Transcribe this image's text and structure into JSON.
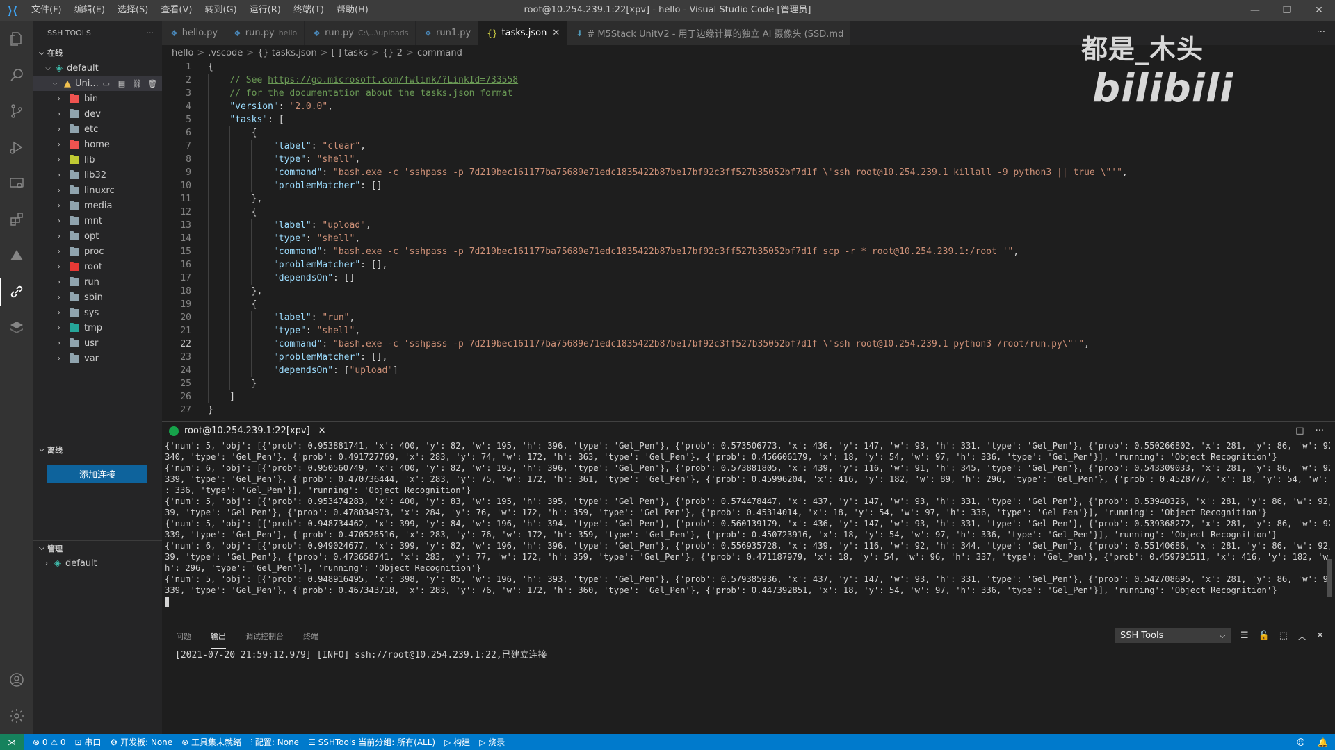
{
  "window": {
    "title": "root@10.254.239.1:22[xpv] - hello - Visual Studio Code [管理员]",
    "menu": [
      "文件(F)",
      "编辑(E)",
      "选择(S)",
      "查看(V)",
      "转到(G)",
      "运行(R)",
      "终端(T)",
      "帮助(H)"
    ],
    "controls": {
      "minimize": "—",
      "restore": "❐",
      "close": "✕"
    }
  },
  "sidebar": {
    "title": "SSH TOOLS",
    "more": "···",
    "online_section": "在线",
    "group": "default",
    "host": "Uni...",
    "folders": [
      {
        "name": "bin",
        "color": "#ef5350"
      },
      {
        "name": "dev",
        "color": "#90a4ae"
      },
      {
        "name": "etc",
        "color": "#90a4ae"
      },
      {
        "name": "home",
        "color": "#ef5350"
      },
      {
        "name": "lib",
        "color": "#c0ca33"
      },
      {
        "name": "lib32",
        "color": "#90a4ae"
      },
      {
        "name": "linuxrc",
        "color": "#90a4ae"
      },
      {
        "name": "media",
        "color": "#90a4ae"
      },
      {
        "name": "mnt",
        "color": "#90a4ae"
      },
      {
        "name": "opt",
        "color": "#90a4ae"
      },
      {
        "name": "proc",
        "color": "#90a4ae"
      },
      {
        "name": "root",
        "color": "#e53935"
      },
      {
        "name": "run",
        "color": "#90a4ae"
      },
      {
        "name": "sbin",
        "color": "#90a4ae"
      },
      {
        "name": "sys",
        "color": "#90a4ae"
      },
      {
        "name": "tmp",
        "color": "#26a69a"
      },
      {
        "name": "usr",
        "color": "#90a4ae"
      },
      {
        "name": "var",
        "color": "#90a4ae"
      }
    ],
    "offline_section": "离线",
    "add_button": "添加连接",
    "manage_section": "管理",
    "manage_group": "default"
  },
  "tabs": [
    {
      "label": "hello.py",
      "desc": "",
      "icon": "python-icon",
      "active": false
    },
    {
      "label": "run.py",
      "desc": "hello",
      "icon": "python-icon",
      "active": false
    },
    {
      "label": "run.py",
      "desc": "C:\\...\\uploads",
      "icon": "python-icon",
      "active": false
    },
    {
      "label": "run1.py",
      "desc": "",
      "icon": "python-icon",
      "active": false
    },
    {
      "label": "tasks.json",
      "desc": "",
      "icon": "json-icon",
      "active": true
    },
    {
      "label": "# M5Stack UnitV2 - 用于边缘计算的独立 AI 摄像头 (SSD.md",
      "desc": "",
      "icon": "markdown-icon",
      "active": false
    }
  ],
  "breadcrumb": [
    "hello",
    ".vscode",
    "{} tasks.json",
    "[ ] tasks",
    "{} 2",
    "command"
  ],
  "editor": {
    "current_line": 22,
    "lines": [
      "{",
      "    // See https://go.microsoft.com/fwlink/?LinkId=733558",
      "    // for the documentation about the tasks.json format",
      "    \"version\": \"2.0.0\",",
      "    \"tasks\": [",
      "        {",
      "            \"label\": \"clear\",",
      "            \"type\": \"shell\",",
      "            \"command\": \"bash.exe -c 'sshpass -p 7d219bec161177ba75689e71edc1835422b87be17bf92c3ff527b35052bf7d1f \\\"ssh root@10.254.239.1 killall -9 python3 || true \\\"'\",",
      "            \"problemMatcher\": []",
      "        },",
      "        {",
      "            \"label\": \"upload\",",
      "            \"type\": \"shell\",",
      "            \"command\": \"bash.exe -c 'sshpass -p 7d219bec161177ba75689e71edc1835422b87be17bf92c3ff527b35052bf7d1f scp -r * root@10.254.239.1:/root '\",",
      "            \"problemMatcher\": [],",
      "            \"dependsOn\": []",
      "        },",
      "        {",
      "            \"label\": \"run\",",
      "            \"type\": \"shell\",",
      "            \"command\": \"bash.exe -c 'sshpass -p 7d219bec161177ba75689e71edc1835422b87be17bf92c3ff527b35052bf7d1f \\\"ssh root@10.254.239.1 python3 /root/run.py\\\"'\",",
      "            \"problemMatcher\": [],",
      "            \"dependsOn\": [\"upload\"]",
      "        }",
      "    ]",
      "}"
    ]
  },
  "watermark": {
    "text": "都是_木头",
    "brand": "bilibili"
  },
  "terminal": {
    "tab_label": "root@10.254.239.1:22[xpv]",
    "lines": [
      "{'num': 5, 'obj': [{'prob': 0.953881741, 'x': 400, 'y': 82, 'w': 195, 'h': 396, 'type': 'Gel_Pen'}, {'prob': 0.573506773, 'x': 436, 'y': 147, 'w': 93, 'h': 331, 'type': 'Gel_Pen'}, {'prob': 0.550266802, 'x': 281, 'y': 86, 'w': 92, 'h':",
      "340, 'type': 'Gel_Pen'}, {'prob': 0.491727769, 'x': 283, 'y': 74, 'w': 172, 'h': 363, 'type': 'Gel_Pen'}, {'prob': 0.456606179, 'x': 18, 'y': 54, 'w': 97, 'h': 336, 'type': 'Gel_Pen'}], 'running': 'Object Recognition'}",
      "{'num': 6, 'obj': [{'prob': 0.950560749, 'x': 400, 'y': 82, 'w': 195, 'h': 396, 'type': 'Gel_Pen'}, {'prob': 0.573881805, 'x': 439, 'y': 116, 'w': 91, 'h': 345, 'type': 'Gel_Pen'}, {'prob': 0.543309033, 'x': 281, 'y': 86, 'w': 92, 'h':",
      "339, 'type': 'Gel_Pen'}, {'prob': 0.470736444, 'x': 283, 'y': 75, 'w': 172, 'h': 361, 'type': 'Gel_Pen'}, {'prob': 0.45996204, 'x': 416, 'y': 182, 'w': 89, 'h': 296, 'type': 'Gel_Pen'}, {'prob': 0.4528777, 'x': 18, 'y': 54, 'w': 97, 'h'",
      ": 336, 'type': 'Gel_Pen'}], 'running': 'Object Recognition'}",
      "{'num': 5, 'obj': [{'prob': 0.953474283, 'x': 400, 'y': 83, 'w': 195, 'h': 395, 'type': 'Gel_Pen'}, {'prob': 0.574478447, 'x': 437, 'y': 147, 'w': 93, 'h': 331, 'type': 'Gel_Pen'}, {'prob': 0.53940326, 'x': 281, 'y': 86, 'w': 92, 'h': 3",
      "39, 'type': 'Gel_Pen'}, {'prob': 0.478034973, 'x': 284, 'y': 76, 'w': 172, 'h': 359, 'type': 'Gel_Pen'}, {'prob': 0.45314014, 'x': 18, 'y': 54, 'w': 97, 'h': 336, 'type': 'Gel_Pen'}], 'running': 'Object Recognition'}",
      "{'num': 5, 'obj': [{'prob': 0.948734462, 'x': 399, 'y': 84, 'w': 196, 'h': 394, 'type': 'Gel_Pen'}, {'prob': 0.560139179, 'x': 436, 'y': 147, 'w': 93, 'h': 331, 'type': 'Gel_Pen'}, {'prob': 0.539368272, 'x': 281, 'y': 86, 'w': 92, 'h':",
      "339, 'type': 'Gel_Pen'}, {'prob': 0.470526516, 'x': 283, 'y': 76, 'w': 172, 'h': 359, 'type': 'Gel_Pen'}, {'prob': 0.450723916, 'x': 18, 'y': 54, 'w': 97, 'h': 336, 'type': 'Gel_Pen'}], 'running': 'Object Recognition'}",
      "{'num': 6, 'obj': [{'prob': 0.949024677, 'x': 399, 'y': 82, 'w': 196, 'h': 396, 'type': 'Gel_Pen'}, {'prob': 0.556935728, 'x': 439, 'y': 116, 'w': 92, 'h': 344, 'type': 'Gel_Pen'}, {'prob': 0.55140686, 'x': 281, 'y': 86, 'w': 92, 'h': 3",
      "39, 'type': 'Gel_Pen'}, {'prob': 0.473658741, 'x': 283, 'y': 77, 'w': 172, 'h': 359, 'type': 'Gel_Pen'}, {'prob': 0.471187979, 'x': 18, 'y': 54, 'w': 96, 'h': 337, 'type': 'Gel_Pen'}, {'prob': 0.459791511, 'x': 416, 'y': 182, 'w': 89, '",
      "h': 296, 'type': 'Gel_Pen'}], 'running': 'Object Recognition'}",
      "{'num': 5, 'obj': [{'prob': 0.948916495, 'x': 398, 'y': 85, 'w': 196, 'h': 393, 'type': 'Gel_Pen'}, {'prob': 0.579385936, 'x': 437, 'y': 147, 'w': 93, 'h': 331, 'type': 'Gel_Pen'}, {'prob': 0.542708695, 'x': 281, 'y': 86, 'w': 92, 'h':",
      "339, 'type': 'Gel_Pen'}, {'prob': 0.467343718, 'x': 283, 'y': 76, 'w': 172, 'h': 360, 'type': 'Gel_Pen'}, {'prob': 0.447392851, 'x': 18, 'y': 54, 'w': 97, 'h': 336, 'type': 'Gel_Pen'}], 'running': 'Object Recognition'}"
    ]
  },
  "panel": {
    "tabs": [
      "问题",
      "输出",
      "调试控制台",
      "终端"
    ],
    "active_tab": 1,
    "select_value": "SSH Tools",
    "output_line": "[2021-07-20 21:59:12.979] [INFO] ssh://root@10.254.239.1:22,已建立连接"
  },
  "statusbar": {
    "errors": "⊗ 0 ⚠ 0",
    "serial": "串口",
    "board": "开发板: None",
    "toolset": "工具集未就绪",
    "config": "配置: None",
    "sshtools": "SSHTools 当前分组: 所有(ALL)",
    "build": "构建",
    "burn": "烧录"
  }
}
